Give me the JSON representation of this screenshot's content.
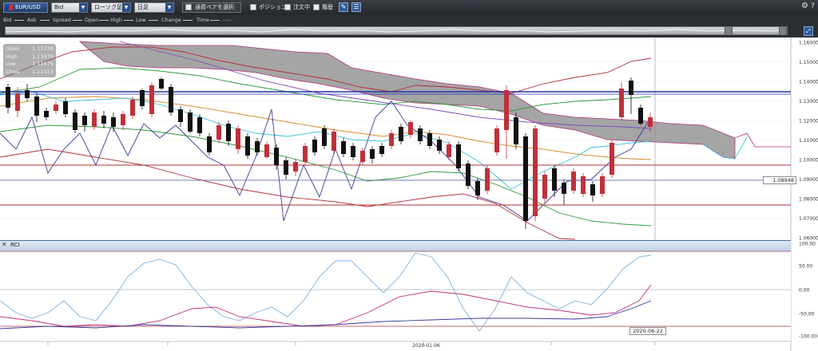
{
  "toolbar": {
    "symbol": "EUR/USD",
    "price_type": "Bid",
    "chart_type": "ローソク足",
    "period": "日足",
    "link_pair_label": "通貨ペアを選択",
    "position_label": "ポジション",
    "orders_label": "注文中",
    "history_label": "履歴"
  },
  "legend": {
    "items": [
      {
        "label": "Bid",
        "color": "#c8c8c8"
      },
      {
        "label": "Ask",
        "color": "#c8c8c8"
      },
      {
        "label": "Spread",
        "color": "#c8c8c8"
      },
      {
        "label": "Open",
        "color": "#c8c8c8"
      },
      {
        "label": "High",
        "color": "#c8c8c8"
      },
      {
        "label": "Low",
        "color": "#c8c8c8"
      },
      {
        "label": "Change",
        "color": "#c8c8c8"
      },
      {
        "label": "Time",
        "color": "#c8c8c8"
      }
    ],
    "time_value": "--:--"
  },
  "ohlc": {
    "open_label": "Open",
    "open_value": "1.11728",
    "high_label": "High",
    "high_value": "1.13479",
    "low_label": "Low",
    "low_value": "1.11675",
    "close_label": "Close",
    "close_value": "1.12153"
  },
  "price_axis": [
    "1.16000",
    "1.15000",
    "1.14000",
    "1.13000",
    "1.12000",
    "1.11000",
    "1.10000",
    "1.09000",
    "1.08000",
    "1.07000",
    "1.06000"
  ],
  "current_price": "1.08948",
  "rci": {
    "title": "RCI",
    "axis": [
      "100.00",
      "50.00",
      "0.00",
      "-50.00",
      "-100.00"
    ]
  },
  "crosshair_date": "2020-06-22",
  "x_axis": {
    "label": "2020-01-06"
  },
  "colors": {
    "bull": "#c0303a",
    "bear": "#111111",
    "cloud": "#8a8a8a",
    "blue_line": "#2233aa",
    "red_line": "#b03030"
  }
}
